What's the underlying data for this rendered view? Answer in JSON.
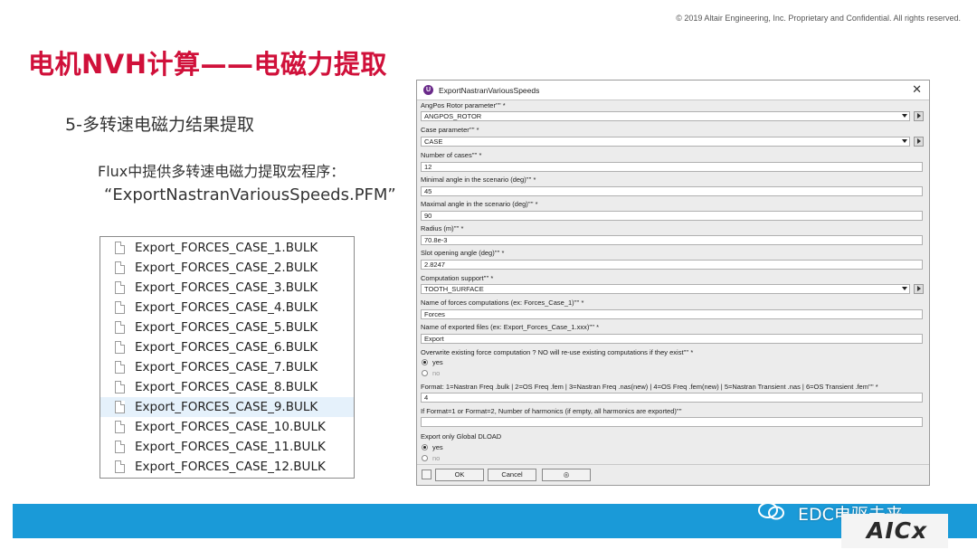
{
  "copyright": "© 2019 Altair Engineering, Inc. Proprietary and Confidential. All rights reserved.",
  "title": "电机NVH计算——电磁力提取",
  "subtitle": "5-多转速电磁力结果提取",
  "description_line1": "Flux中提供多转速电磁力提取宏程序：",
  "description_line2": "“ExportNastranVariousSpeeds.PFM”",
  "file_list": [
    "Export_FORCES_CASE_1.BULK",
    "Export_FORCES_CASE_2.BULK",
    "Export_FORCES_CASE_3.BULK",
    "Export_FORCES_CASE_4.BULK",
    "Export_FORCES_CASE_5.BULK",
    "Export_FORCES_CASE_6.BULK",
    "Export_FORCES_CASE_7.BULK",
    "Export_FORCES_CASE_8.BULK",
    "Export_FORCES_CASE_9.BULK",
    "Export_FORCES_CASE_10.BULK",
    "Export_FORCES_CASE_11.BULK",
    "Export_FORCES_CASE_12.BULK"
  ],
  "file_list_selected_index": 8,
  "dialog": {
    "title": "ExportNastranVariousSpeeds",
    "close": "✕",
    "fields": {
      "angpos_label": "AngPos Rotor parameter'''' *",
      "angpos_value": "ANGPOS_ROTOR",
      "case_label": "Case parameter'''' *",
      "case_value": "CASE",
      "ncases_label": "Number of cases'''' *",
      "ncases_value": "12",
      "minangle_label": "Minimal angle in the scenario (deg)'''' *",
      "minangle_value": "45",
      "maxangle_label": "Maximal angle in the scenario (deg)'''' *",
      "maxangle_value": "90",
      "radius_label": "Radius (m)'''' *",
      "radius_value": "70.8e-3",
      "slot_label": "Slot opening angle (deg)'''' *",
      "slot_value": "2.8247",
      "support_label": "Computation support'''' *",
      "support_value": "TOOTH_SURFACE",
      "forcesname_label": "Name of forces computations (ex: Forces_Case_1)'''' *",
      "forcesname_value": "Forces",
      "exportname_label": "Name of exported files (ex: Export_Forces_Case_1.xxx)'''' *",
      "exportname_value": "Export",
      "overwrite_label": "Overwrite existing force computation ? NO will re-use existing computations if they exist'''' *",
      "overwrite_yes": "yes",
      "overwrite_no": "no",
      "format_label": "Format: 1=Nastran Freq .bulk | 2=OS Freq .fem | 3=Nastran Freq .nas(new) | 4=OS Freq .fem(new) | 5=Nastran Transient .nas | 6=OS Transient .fem'''' *",
      "format_value": "4",
      "harmonics_label": "If Format=1 or Format=2, Number of harmonics (if empty, all harmonics are exported)''''",
      "harmonics_value": "",
      "dload_label": "Export only Global DLOAD",
      "dload_yes": "yes",
      "dload_no": "no"
    },
    "buttons": {
      "ok": "OK",
      "cancel": "Cancel",
      "help": "◎"
    }
  },
  "watermark": {
    "text": "EDC电驱未来",
    "logo": "AICx"
  },
  "colors": {
    "title_red": "#d0103a",
    "blue_bar": "#1a9ad8",
    "selection": "#e5f1fb"
  }
}
